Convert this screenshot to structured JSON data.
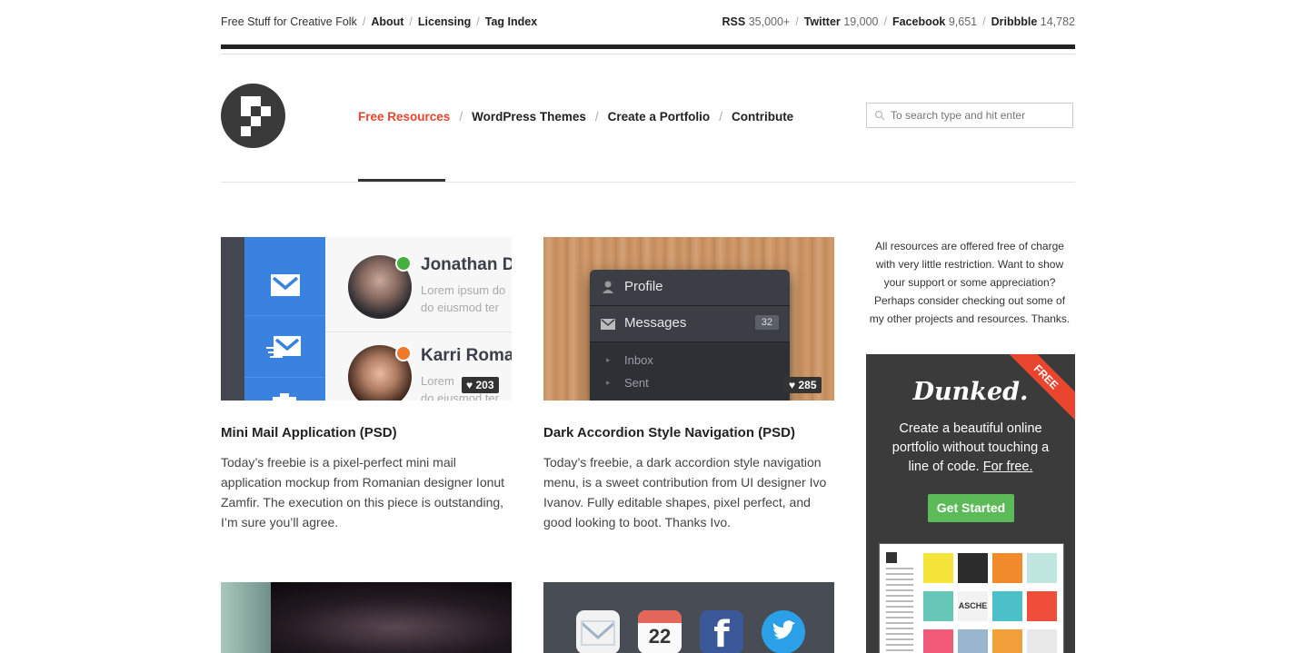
{
  "topbar": {
    "tagline": "Free Stuff for Creative Folk",
    "links": [
      "About",
      "Licensing",
      "Tag Index"
    ],
    "stats": [
      {
        "label": "RSS",
        "value": "35,000+"
      },
      {
        "label": "Twitter",
        "value": "19,000"
      },
      {
        "label": "Facebook",
        "value": "9,651"
      },
      {
        "label": "Dribbble",
        "value": "14,782"
      }
    ]
  },
  "nav": {
    "items": [
      "Free Resources",
      "WordPress Themes",
      "Create a Portfolio",
      "Contribute"
    ],
    "active_index": 0
  },
  "search": {
    "placeholder": "To search type and hit enter"
  },
  "posts": [
    {
      "title": "Mini Mail Application (PSD)",
      "excerpt": "Today’s freebie is a pixel-perfect mini mail application mockup from Romanian designer Ionut Zamfir. The execution on this piece is outstanding, I’m sure you’ll agree.",
      "likes": "203",
      "thumb": {
        "contacts": [
          {
            "name": "Jonathan D",
            "line1": "Lorem ipsum do",
            "line2": "do eiusmod ter"
          },
          {
            "name": "Karri Roman",
            "line1": "Lorem",
            "line2": "do eiusmod ter"
          }
        ]
      }
    },
    {
      "title": "Dark Accordion Style Navigation (PSD)",
      "excerpt": "Today’s freebie, a dark accordion style navigation menu, is a sweet contribution from UI designer Ivo Ivanov. Fully editable shapes, pixel perfect, and good looking to boot. Thanks Ivo.",
      "likes": "285",
      "thumb": {
        "menu": [
          "Profile",
          "Messages"
        ],
        "badge": "32",
        "submenu": [
          "Inbox",
          "Sent"
        ]
      }
    }
  ],
  "icons_thumb": {
    "calendar_day": "22"
  },
  "sidebar": {
    "intro": "All resources are offered free of charge with very little restriction. Want to show your support or some appreciation? Perhaps consider checking out some of my other projects and resources. Thanks.",
    "ad": {
      "ribbon": "FREE",
      "brand": "Dunked.",
      "pitch": "Create a beautiful online portfolio without touching a line of code.",
      "pitch_link": "For free.",
      "cta": "Get Started",
      "tile_text": "ASCHE"
    }
  },
  "colors": {
    "accent": "#e8442e",
    "dark": "#222222",
    "cta_green": "#5dba58",
    "ad_bg": "#3b3b3b"
  }
}
